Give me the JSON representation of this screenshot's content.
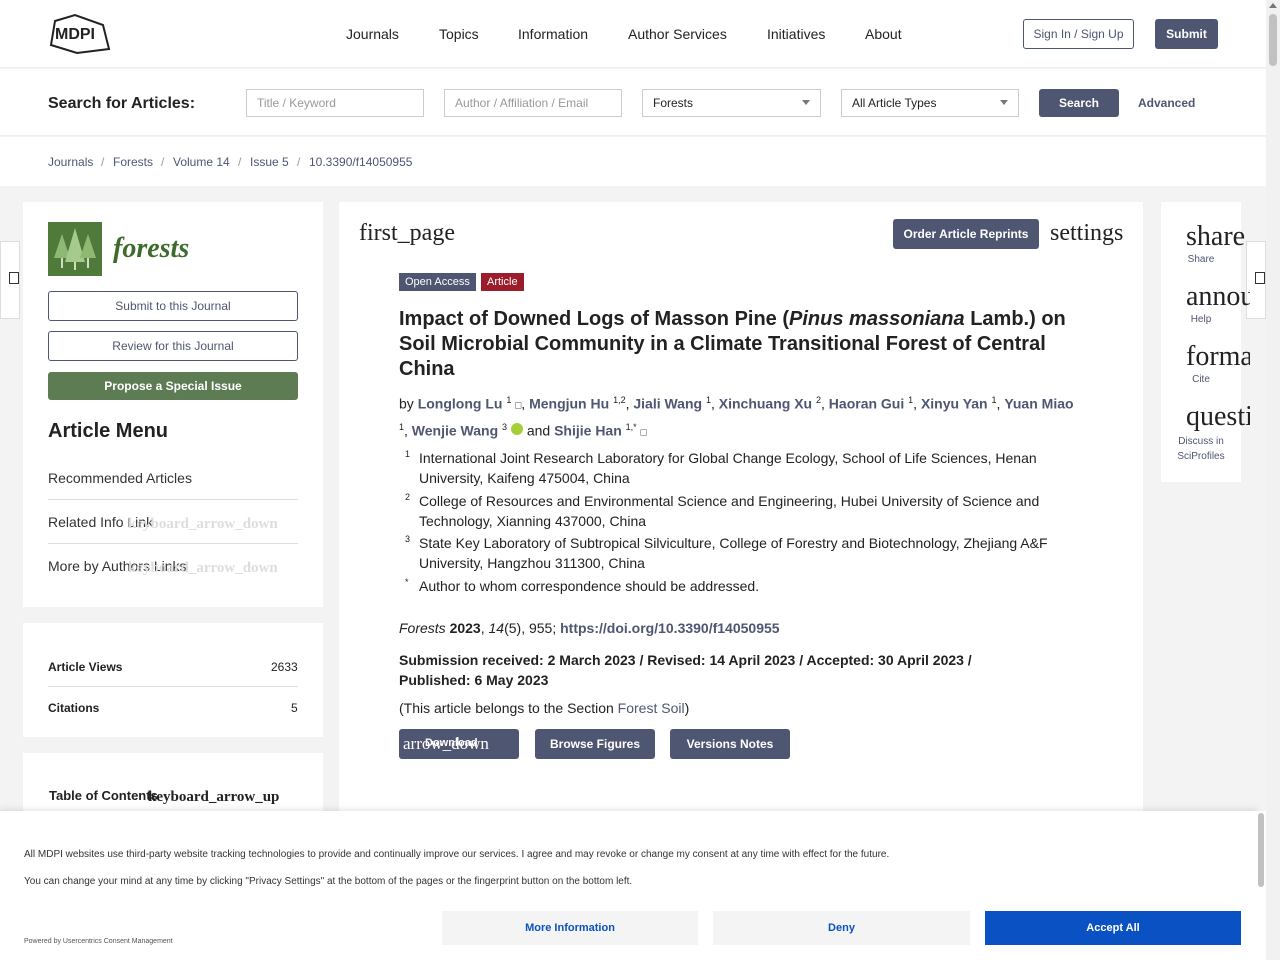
{
  "header": {
    "logo_text": "MDPI",
    "nav": [
      "Journals",
      "Topics",
      "Information",
      "Author Services",
      "Initiatives",
      "About"
    ],
    "signin": "Sign In / Sign Up",
    "submit": "Submit"
  },
  "search": {
    "label": "Search for Articles:",
    "title_placeholder": "Title / Keyword",
    "author_placeholder": "Author / Affiliation / Email",
    "journal_value": "Forests",
    "type_value": "All Article Types",
    "search_button": "Search",
    "advanced": "Advanced"
  },
  "breadcrumb": [
    "Journals",
    "Forests",
    "Volume 14",
    "Issue 5",
    "10.3390/f14050955"
  ],
  "sidebar": {
    "journal_name": "forests",
    "submit_btn": "Submit to this Journal",
    "review_btn": "Review for this Journal",
    "propose_btn": "Propose a Special Issue",
    "menu_title": "Article Menu",
    "menu_items": [
      "Recommended Articles",
      "Related Info Link",
      "More by Authors Links"
    ],
    "expand_icon_text": "keyboard_arrow_down",
    "stats": [
      {
        "label": "Article Views",
        "value": "2633"
      },
      {
        "label": "Citations",
        "value": "5"
      }
    ],
    "toc_label": "Table of Contents",
    "toc_icon_text": "keyboard_arrow_up"
  },
  "article": {
    "first_page_icon": "first_page",
    "settings_icon": "settings",
    "reprints_btn": "Order Article Reprints",
    "badges": [
      "Open Access",
      "Article"
    ],
    "title_part1": "Impact of Downed Logs of Masson Pine (",
    "title_italic": "Pinus massoniana",
    "title_part2": " Lamb.) on Soil Microbial Community in a Climate Transitional Forest of Central China",
    "authors_by": "by",
    "authors": [
      {
        "name": "Longlong Lu",
        "sup": "1"
      },
      {
        "name": "Mengjun Hu",
        "sup": "1,2"
      },
      {
        "name": "Jiali Wang",
        "sup": "1"
      },
      {
        "name": "Xinchuang Xu",
        "sup": "2"
      },
      {
        "name": "Haoran Gui",
        "sup": "1"
      },
      {
        "name": "Xinyu Yan",
        "sup": "1"
      },
      {
        "name": "Yuan Miao",
        "sup": "1"
      },
      {
        "name": "Wenjie Wang",
        "sup": "3"
      },
      {
        "name": "Shijie Han",
        "sup": "1,*"
      }
    ],
    "and_word": "and",
    "affiliations": [
      {
        "num": "1",
        "text": "International Joint Research Laboratory for Global Change Ecology, School of Life Sciences, Henan University, Kaifeng 475004, China"
      },
      {
        "num": "2",
        "text": "College of Resources and Environmental Science and Engineering, Hubei University of Science and Technology, Xianning 437000, China"
      },
      {
        "num": "3",
        "text": "State Key Laboratory of Subtropical Silviculture, College of Forestry and Biotechnology, Zhejiang A&F University, Hangzhou 311300, China"
      },
      {
        "num": "*",
        "text": "Author to whom correspondence should be addressed."
      }
    ],
    "cite_journal": "Forests",
    "cite_year": "2023",
    "cite_volume": "14",
    "cite_rest": "(5), 955; ",
    "cite_doi": "https://doi.org/10.3390/f14050955",
    "dates": "Submission received: 2 March 2023 / Revised: 14 April 2023 / Accepted: 30 April 2023 / Published: 6 May 2023",
    "section_prefix": "(This article belongs to the Section ",
    "section_name": "Forest Soil",
    "section_suffix": ")",
    "download_btn": "Download",
    "download_icon_text": "arrow_down",
    "browse_btn": "Browse Figures",
    "versions_btn": "Versions Notes"
  },
  "share_panel": [
    {
      "icon": "share",
      "label": "Share"
    },
    {
      "icon": "announcement",
      "label": "Help"
    },
    {
      "icon": "format_quote",
      "label": "Cite"
    },
    {
      "icon": "question_answer",
      "label": "Discuss in SciProfiles"
    }
  ],
  "consent": {
    "line1": "All MDPI websites use third-party website tracking technologies to provide and continually improve our services. I agree and may revoke or change my consent at any time with effect for the future.",
    "line2": "You can change your mind at any time by clicking \"Privacy Settings\" at the bottom of the pages or the fingerprint button on the bottom left.",
    "powered": "Powered by Usercentrics Consent Management",
    "more_info": "More Information",
    "deny": "Deny",
    "accept": "Accept All"
  },
  "colors": {
    "primary": "#4f5671",
    "forest_green": "#5e7c53",
    "article_badge": "#9b1c2a",
    "accept_blue": "#0a52c4"
  }
}
